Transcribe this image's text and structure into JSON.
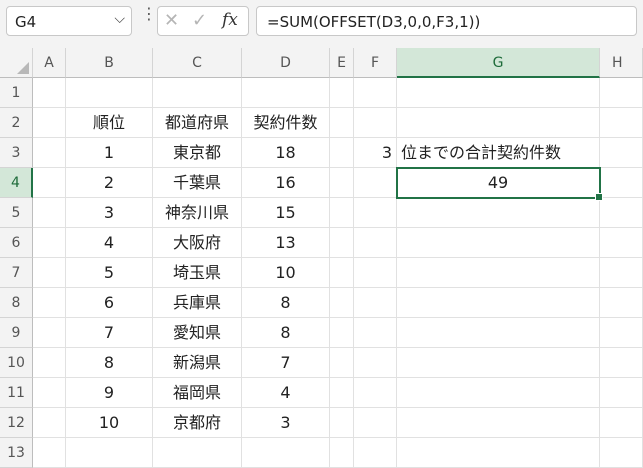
{
  "name_box": {
    "value": "G4",
    "chevron_icon": "chevron-down-icon"
  },
  "formula_bar": {
    "cancel_icon": "x-icon",
    "enter_icon": "check-icon",
    "fx_label": "fx",
    "formula": "=SUM(OFFSET(D3,0,0,F3,1))"
  },
  "columns": [
    "A",
    "B",
    "C",
    "D",
    "E",
    "F",
    "G",
    "H"
  ],
  "active_column": "G",
  "rows": [
    "1",
    "2",
    "3",
    "4",
    "5",
    "6",
    "7",
    "8",
    "9",
    "10",
    "11",
    "12",
    "13"
  ],
  "active_row": "4",
  "table": {
    "headers": {
      "rank": "順位",
      "pref": "都道府県",
      "count": "契約件数"
    },
    "rows": [
      {
        "rank": "1",
        "pref": "東京都",
        "count": "18"
      },
      {
        "rank": "2",
        "pref": "千葉県",
        "count": "16"
      },
      {
        "rank": "3",
        "pref": "神奈川県",
        "count": "15"
      },
      {
        "rank": "4",
        "pref": "大阪府",
        "count": "13"
      },
      {
        "rank": "5",
        "pref": "埼玉県",
        "count": "10"
      },
      {
        "rank": "6",
        "pref": "兵庫県",
        "count": "8"
      },
      {
        "rank": "7",
        "pref": "愛知県",
        "count": "8"
      },
      {
        "rank": "8",
        "pref": "新潟県",
        "count": "7"
      },
      {
        "rank": "9",
        "pref": "福岡県",
        "count": "4"
      },
      {
        "rank": "10",
        "pref": "京都府",
        "count": "3"
      }
    ]
  },
  "f3_value": "3",
  "g3_label": "位までの合計契約件数",
  "g4_result": "49",
  "colors": {
    "accent": "#217346",
    "header_active_bg": "#d3e7d8"
  }
}
